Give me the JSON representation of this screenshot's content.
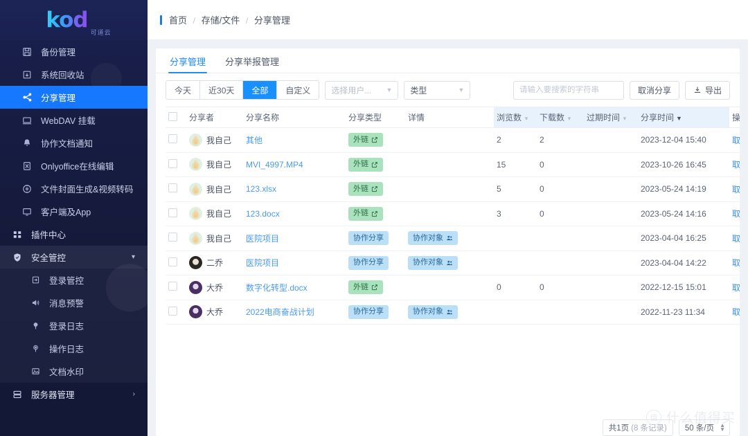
{
  "brand": {
    "logo_text": "kod",
    "logo_sub": "可道云",
    "accent": "#1677ff",
    "logo_gradient_from": "#32d4f5",
    "logo_gradient_to": "#8d4ff0"
  },
  "sidebar": {
    "items": [
      {
        "label": "备份管理",
        "icon": "save-icon",
        "level": "top",
        "active": false
      },
      {
        "label": "系统回收站",
        "icon": "recycle-bin-icon",
        "level": "top",
        "active": false
      },
      {
        "label": "分享管理",
        "icon": "share-icon",
        "level": "top",
        "active": true
      },
      {
        "label": "WebDAV 挂载",
        "icon": "server-mount-icon",
        "level": "top",
        "active": false
      },
      {
        "label": "协作文档通知",
        "icon": "bell-icon",
        "level": "top",
        "active": false
      },
      {
        "label": "Onlyoffice在线编辑",
        "icon": "document-edit-icon",
        "level": "top",
        "active": false
      },
      {
        "label": "文件封面生成&视频转码",
        "icon": "media-transcode-icon",
        "level": "top",
        "active": false
      },
      {
        "label": "客户端及App",
        "icon": "monitor-icon",
        "level": "top",
        "active": false
      },
      {
        "label": "插件中心",
        "icon": "grid-icon",
        "level": "group",
        "active": false
      },
      {
        "label": "安全管控",
        "icon": "shield-check-icon",
        "level": "group",
        "active": false,
        "expanded": true,
        "chevron": "chevron-down-icon"
      },
      {
        "label": "登录管控",
        "icon": "login-control-icon",
        "level": "sub",
        "active": false
      },
      {
        "label": "消息预警",
        "icon": "megaphone-icon",
        "level": "sub",
        "active": false
      },
      {
        "label": "登录日志",
        "icon": "location-pin-icon",
        "level": "sub",
        "active": false
      },
      {
        "label": "操作日志",
        "icon": "location-pin-outline-icon",
        "level": "sub",
        "active": false
      },
      {
        "label": "文档水印",
        "icon": "image-icon",
        "level": "sub",
        "active": false
      },
      {
        "label": "服务器管理",
        "icon": "server-icon",
        "level": "group",
        "active": false,
        "chevron": "chevron-right-icon"
      }
    ]
  },
  "breadcrumb": {
    "items": [
      "首页",
      "存储/文件",
      "分享管理"
    ],
    "separator": "/"
  },
  "tabs": [
    {
      "label": "分享管理",
      "active": true
    },
    {
      "label": "分享举报管理",
      "active": false
    }
  ],
  "toolbar": {
    "range_buttons": [
      {
        "label": "今天",
        "active": false
      },
      {
        "label": "近30天",
        "active": false
      },
      {
        "label": "全部",
        "active": true
      },
      {
        "label": "自定义",
        "active": false
      }
    ],
    "user_select": {
      "value": "选择用户...",
      "is_placeholder": true
    },
    "type_select": {
      "value": "类型",
      "is_placeholder": false
    },
    "search": {
      "value": "",
      "placeholder": "请输入要搜索的字符串",
      "icon": "search-icon"
    },
    "cancel_share_button": "取消分享",
    "export_button": {
      "label": "导出",
      "icon": "download-icon"
    }
  },
  "table": {
    "columns": [
      {
        "label": "",
        "key": "checkbox",
        "sortable": false
      },
      {
        "label": "分享者",
        "key": "sharer",
        "sortable": false
      },
      {
        "label": "分享名称",
        "key": "name",
        "sortable": false
      },
      {
        "label": "分享类型",
        "key": "type",
        "sortable": false
      },
      {
        "label": "详情",
        "key": "detail",
        "sortable": false
      },
      {
        "label": "浏览数",
        "key": "views",
        "sortable": true,
        "sort_state": "none"
      },
      {
        "label": "下载数",
        "key": "downloads",
        "sortable": true,
        "sort_state": "none"
      },
      {
        "label": "过期时间",
        "key": "expire",
        "sortable": true,
        "sort_state": "none"
      },
      {
        "label": "分享时间",
        "key": "shared_at",
        "sortable": true,
        "sort_state": "desc"
      },
      {
        "label": "操作",
        "key": "action",
        "sortable": false
      }
    ],
    "rows": [
      {
        "checked": false,
        "avatar": "a1",
        "sharer": "我自己",
        "name": "其他",
        "type_tag": "外链",
        "type_tag_color": "green",
        "type_tag_icon": "external-link-icon",
        "detail_tag": "",
        "detail_tag_icon": "",
        "views": "2",
        "downloads": "2",
        "expire": "",
        "shared_at": "2023-12-04 15:40",
        "action": "取消分享"
      },
      {
        "checked": false,
        "avatar": "a1",
        "sharer": "我自己",
        "name": "MVI_4997.MP4",
        "type_tag": "外链",
        "type_tag_color": "green",
        "type_tag_icon": "external-link-icon",
        "detail_tag": "",
        "detail_tag_icon": "",
        "views": "15",
        "downloads": "0",
        "expire": "",
        "shared_at": "2023-10-26 16:45",
        "action": "取消分享"
      },
      {
        "checked": false,
        "avatar": "a1",
        "sharer": "我自己",
        "name": "123.xlsx",
        "type_tag": "外链",
        "type_tag_color": "green",
        "type_tag_icon": "external-link-icon",
        "detail_tag": "",
        "detail_tag_icon": "",
        "views": "5",
        "downloads": "0",
        "expire": "",
        "shared_at": "2023-05-24 14:19",
        "action": "取消分享"
      },
      {
        "checked": false,
        "avatar": "a1",
        "sharer": "我自己",
        "name": "123.docx",
        "type_tag": "外链",
        "type_tag_color": "green",
        "type_tag_icon": "external-link-icon",
        "detail_tag": "",
        "detail_tag_icon": "",
        "views": "3",
        "downloads": "0",
        "expire": "",
        "shared_at": "2023-05-24 14:16",
        "action": "取消分享"
      },
      {
        "checked": false,
        "avatar": "a1",
        "sharer": "我自己",
        "name": "医院项目",
        "type_tag": "协作分享",
        "type_tag_color": "blue",
        "type_tag_icon": "",
        "detail_tag": "协作对象",
        "detail_tag_icon": "people-icon",
        "views": "",
        "downloads": "",
        "expire": "",
        "shared_at": "2023-04-04 16:25",
        "action": "取消分享"
      },
      {
        "checked": false,
        "avatar": "a2",
        "sharer": "二乔",
        "name": "医院项目",
        "type_tag": "协作分享",
        "type_tag_color": "blue",
        "type_tag_icon": "",
        "detail_tag": "协作对象",
        "detail_tag_icon": "people-icon",
        "views": "",
        "downloads": "",
        "expire": "",
        "shared_at": "2023-04-04 14:22",
        "action": "取消分享"
      },
      {
        "checked": false,
        "avatar": "a3",
        "sharer": "大乔",
        "name": "数字化转型.docx",
        "type_tag": "外链",
        "type_tag_color": "green",
        "type_tag_icon": "external-link-icon",
        "detail_tag": "",
        "detail_tag_icon": "",
        "views": "0",
        "downloads": "0",
        "expire": "",
        "shared_at": "2022-12-15 15:01",
        "action": "取消分享"
      },
      {
        "checked": false,
        "avatar": "a3",
        "sharer": "大乔",
        "name": "2022电商奋战计划",
        "type_tag": "协作分享",
        "type_tag_color": "blue",
        "type_tag_icon": "",
        "detail_tag": "协作对象",
        "detail_tag_icon": "people-icon",
        "views": "",
        "downloads": "",
        "expire": "",
        "shared_at": "2022-11-23 11:34",
        "action": "取消分享"
      }
    ]
  },
  "pagination": {
    "pages_text": "共1页",
    "records_text": "(8 条记录)",
    "page_size": "50 条/页"
  },
  "watermark": {
    "badge": "值",
    "text": "什么值得买"
  }
}
